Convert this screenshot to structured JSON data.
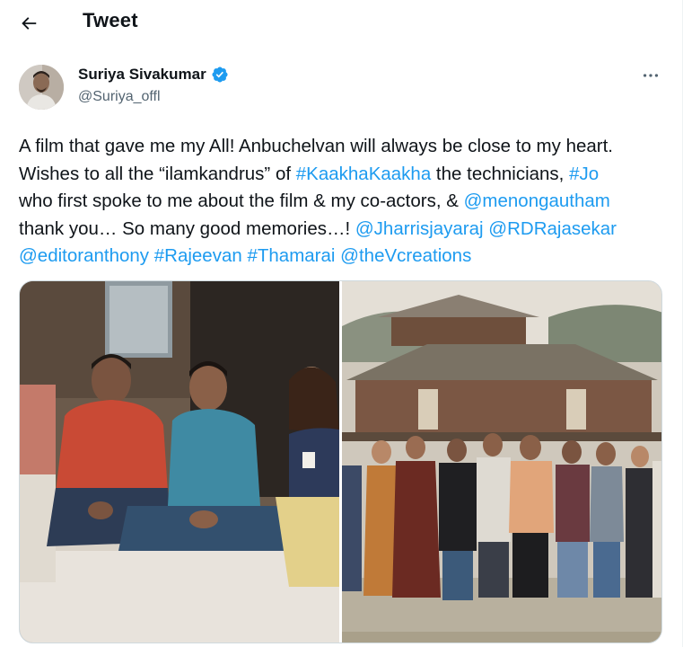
{
  "header": {
    "title": "Tweet",
    "back_icon": "arrow-left-icon"
  },
  "author": {
    "name": "Suriya Sivakumar",
    "handle": "@Suriya_offl",
    "verified_icon": "verified-badge-icon",
    "verified_color": "#1d9bf0"
  },
  "more_icon": "more-horizontal-icon",
  "tweet": {
    "l1": "A film that gave me my All! Anbuchelvan will always be close to my heart.",
    "l2_a": "Wishes to all the “ilamkandrus” of ",
    "l2_tag1": "#KaakhaKaakha",
    "l2_b": " the technicians, ",
    "l2_tag2": "#Jo",
    "l3_a": "who first spoke to me about the film & my co-actors, & ",
    "l3_mention": "@menongautham",
    "l4_a": "thank you… So many good memories…! ",
    "l4_m1": "@Jharrisjayaraj",
    "l4_sp": " ",
    "l4_m2": "@RDRajasekar",
    "l5_m1": "@editoranthony",
    "l5_t1": "#Rajeevan",
    "l5_t2": "#Thamarai",
    "l5_m2": "@theVcreations",
    "space": " "
  },
  "colors": {
    "text": "#0f1419",
    "secondary": "#536471",
    "link": "#1d9bf0",
    "border": "#cfd9de"
  }
}
